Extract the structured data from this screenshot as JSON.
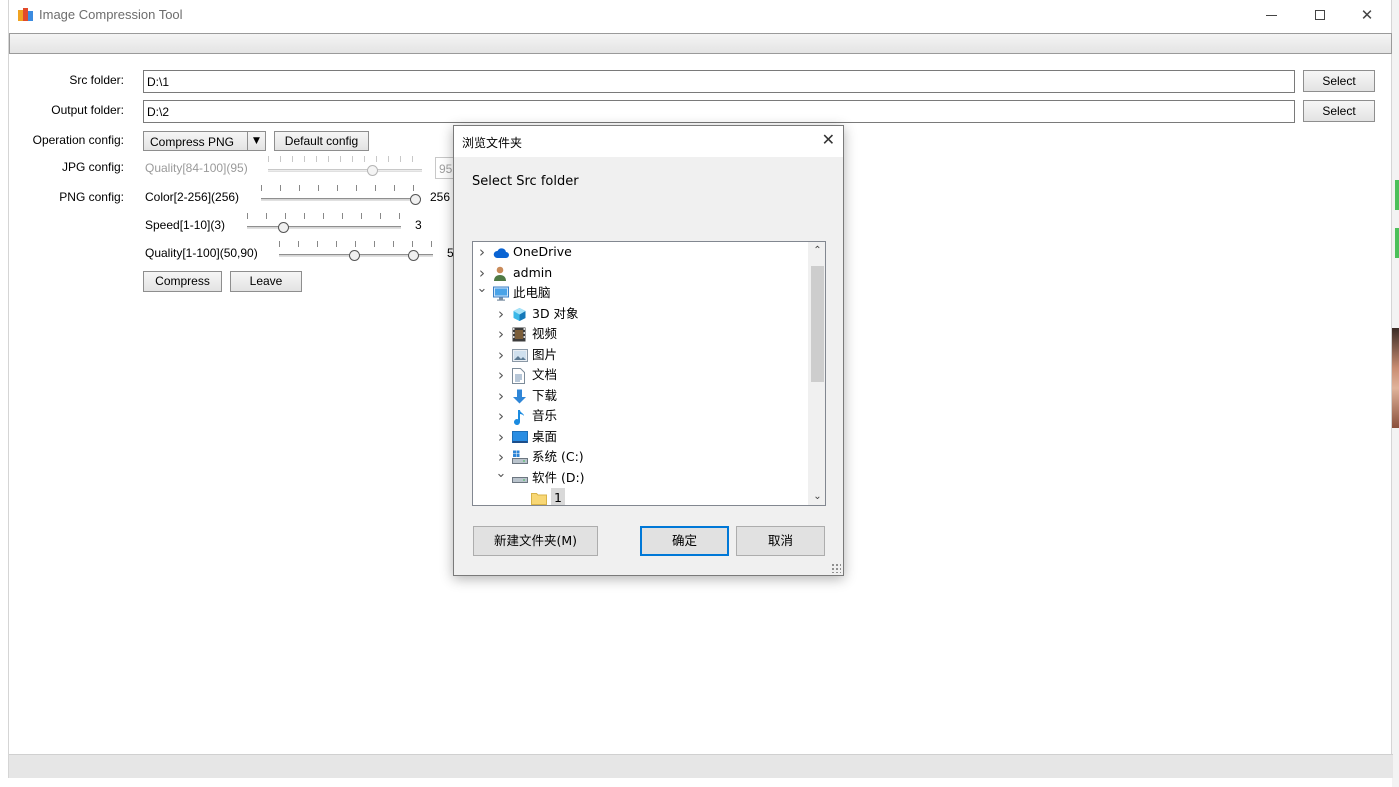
{
  "window": {
    "title": "Image Compression Tool",
    "controls": {
      "minimize": "—",
      "maximize": "☐",
      "close": "✕"
    }
  },
  "form": {
    "src_label": "Src folder:",
    "src_value": "D:\\1",
    "output_label": "Output folder:",
    "output_value": "D:\\2",
    "select_label": "Select",
    "operation_label": "Operation config:",
    "operation_selected": "Compress PNG",
    "default_config_label": "Default config",
    "jpg_label": "JPG config:",
    "jpg_quality_label": "Quality[84-100](95)",
    "jpg_quality_value": "95",
    "png_label": "PNG config:",
    "png_color_label": "Color[2-256](256)",
    "png_color_value": "256",
    "png_speed_label": "Speed[1-10](3)",
    "png_speed_value": "3",
    "png_quality_label": "Quality[1-100](50,90)",
    "png_quality_value": "5",
    "compress_label": "Compress",
    "leave_label": "Leave",
    "sliders": {
      "jpg_quality": 0.69,
      "png_color": 1.0,
      "png_speed": 0.22,
      "png_quality_low": 0.49,
      "png_quality_high": 0.9
    }
  },
  "dialog": {
    "title": "浏览文件夹",
    "close": "✕",
    "description": "Select Src folder",
    "tree": [
      {
        "label": "OneDrive",
        "icon": "cloud-icon",
        "expander": "collapsed"
      },
      {
        "label": "admin",
        "icon": "user-icon",
        "expander": "collapsed"
      },
      {
        "label": "此电脑",
        "icon": "computer-icon",
        "expander": "expanded"
      },
      {
        "label": "3D 对象",
        "icon": "cube-icon",
        "expander": "collapsed"
      },
      {
        "label": "视频",
        "icon": "video-icon",
        "expander": "collapsed"
      },
      {
        "label": "图片",
        "icon": "picture-icon",
        "expander": "collapsed"
      },
      {
        "label": "文档",
        "icon": "document-icon",
        "expander": "collapsed"
      },
      {
        "label": "下载",
        "icon": "download-icon",
        "expander": "collapsed"
      },
      {
        "label": "音乐",
        "icon": "music-icon",
        "expander": "collapsed"
      },
      {
        "label": "桌面",
        "icon": "desktop-icon",
        "expander": "collapsed"
      },
      {
        "label": "系统 (C:)",
        "icon": "system-drive-icon",
        "expander": "collapsed"
      },
      {
        "label": "软件 (D:)",
        "icon": "drive-icon",
        "expander": "expanded"
      },
      {
        "label": "1",
        "icon": "folder-icon",
        "expander": "none",
        "selected": true
      }
    ],
    "new_folder_label": "新建文件夹(M)",
    "ok_label": "确定",
    "cancel_label": "取消"
  },
  "colors": {
    "accent": "#0078d7",
    "onedrive": "#0a64d3",
    "folder": "#f8d775"
  }
}
